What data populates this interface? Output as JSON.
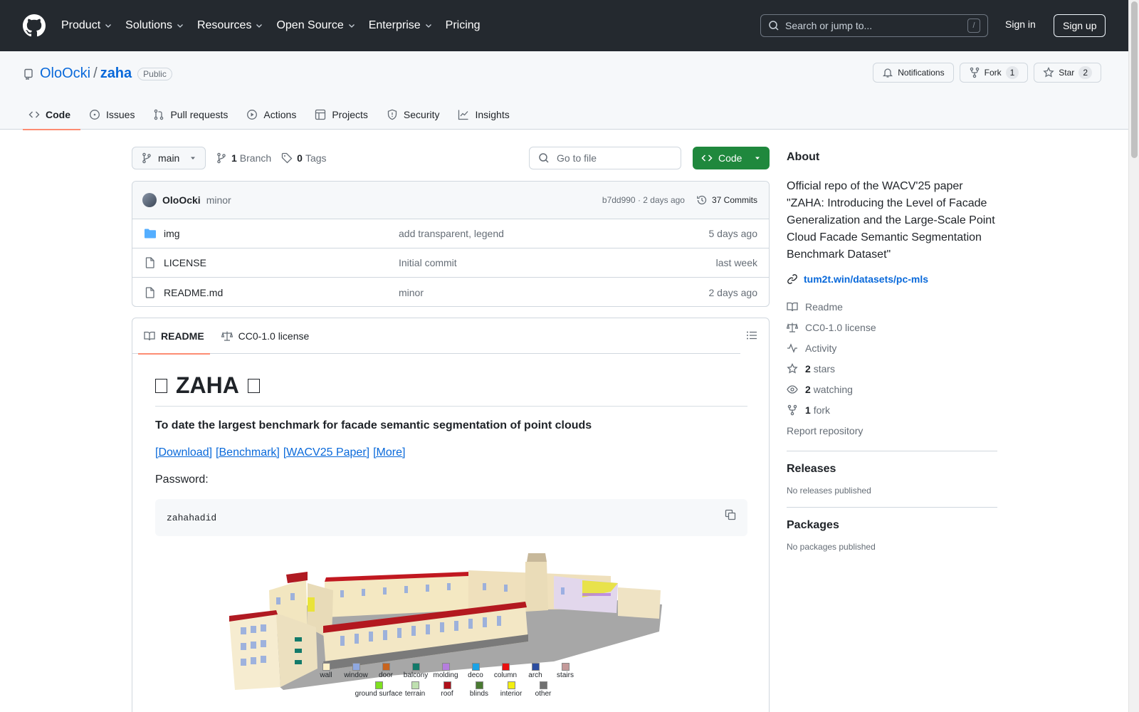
{
  "header": {
    "nav": [
      "Product",
      "Solutions",
      "Resources",
      "Open Source",
      "Enterprise",
      "Pricing"
    ],
    "search_placeholder": "Search or jump to...",
    "search_shortcut": "/",
    "sign_in": "Sign in",
    "sign_up": "Sign up"
  },
  "repo": {
    "owner": "OloOcki",
    "separator": "/",
    "name": "zaha",
    "visibility": "Public",
    "notifications_label": "Notifications",
    "fork_label": "Fork",
    "fork_count": "1",
    "star_label": "Star",
    "star_count": "2",
    "tabs": [
      "Code",
      "Issues",
      "Pull requests",
      "Actions",
      "Projects",
      "Security",
      "Insights"
    ]
  },
  "browser": {
    "branch": "main",
    "branch_count": "1",
    "branch_label": "Branch",
    "tag_count": "0",
    "tag_label": "Tags",
    "goto_placeholder": "Go to file",
    "code_button": "Code",
    "last_commit": {
      "author": "OloOcki",
      "message": "minor",
      "hash_time": "b7dd990 · 2 days ago",
      "commits": "37 Commits"
    },
    "files": [
      {
        "name": "img",
        "type": "folder",
        "commit": "add transparent, legend",
        "date": "5 days ago"
      },
      {
        "name": "LICENSE",
        "type": "file",
        "commit": "Initial commit",
        "date": "last week"
      },
      {
        "name": "README.md",
        "type": "file",
        "commit": "minor",
        "date": "2 days ago"
      }
    ]
  },
  "readme": {
    "tab_readme": "README",
    "tab_license": "CC0-1.0 license",
    "title": "ZAHA",
    "lead": "To date the largest benchmark for facade semantic segmentation of point clouds",
    "links": [
      "[Download]",
      "[Benchmark]",
      "[WACV25 Paper]",
      "[More]"
    ],
    "password_label": "Password:",
    "password": "zahahadid",
    "legend_row1": [
      "wall",
      "window",
      "door",
      "balcony",
      "molding",
      "deco",
      "column",
      "arch",
      "stairs"
    ],
    "legend_row2": [
      "ground surface",
      "terrain",
      "roof",
      "blinds",
      "interior",
      "other"
    ],
    "legend_colors1": [
      "#fdf0c8",
      "#8fa8e0",
      "#c8641e",
      "#137a6a",
      "#b57ede",
      "#1aa3e6",
      "#e81010",
      "#2c4da0",
      "#c49a9a"
    ],
    "legend_colors2": [
      "#7fe020",
      "#bfe0b0",
      "#b0101a",
      "#4a7a32",
      "#f2ee10",
      "#707070"
    ]
  },
  "about": {
    "heading": "About",
    "description": "Official repo of the WACV'25 paper \"ZAHA: Introducing the Level of Facade Generalization and the Large-Scale Point Cloud Facade Semantic Segmentation Benchmark Dataset\"",
    "website": "tum2t.win/datasets/pc-mls",
    "readme": "Readme",
    "license": "CC0-1.0 license",
    "activity": "Activity",
    "stars_count": "2",
    "stars_label": "stars",
    "watching_count": "2",
    "watching_label": "watching",
    "forks_count": "1",
    "forks_label": "fork",
    "report": "Report repository"
  },
  "releases": {
    "heading": "Releases",
    "empty": "No releases published"
  },
  "packages": {
    "heading": "Packages",
    "empty": "No packages published"
  }
}
